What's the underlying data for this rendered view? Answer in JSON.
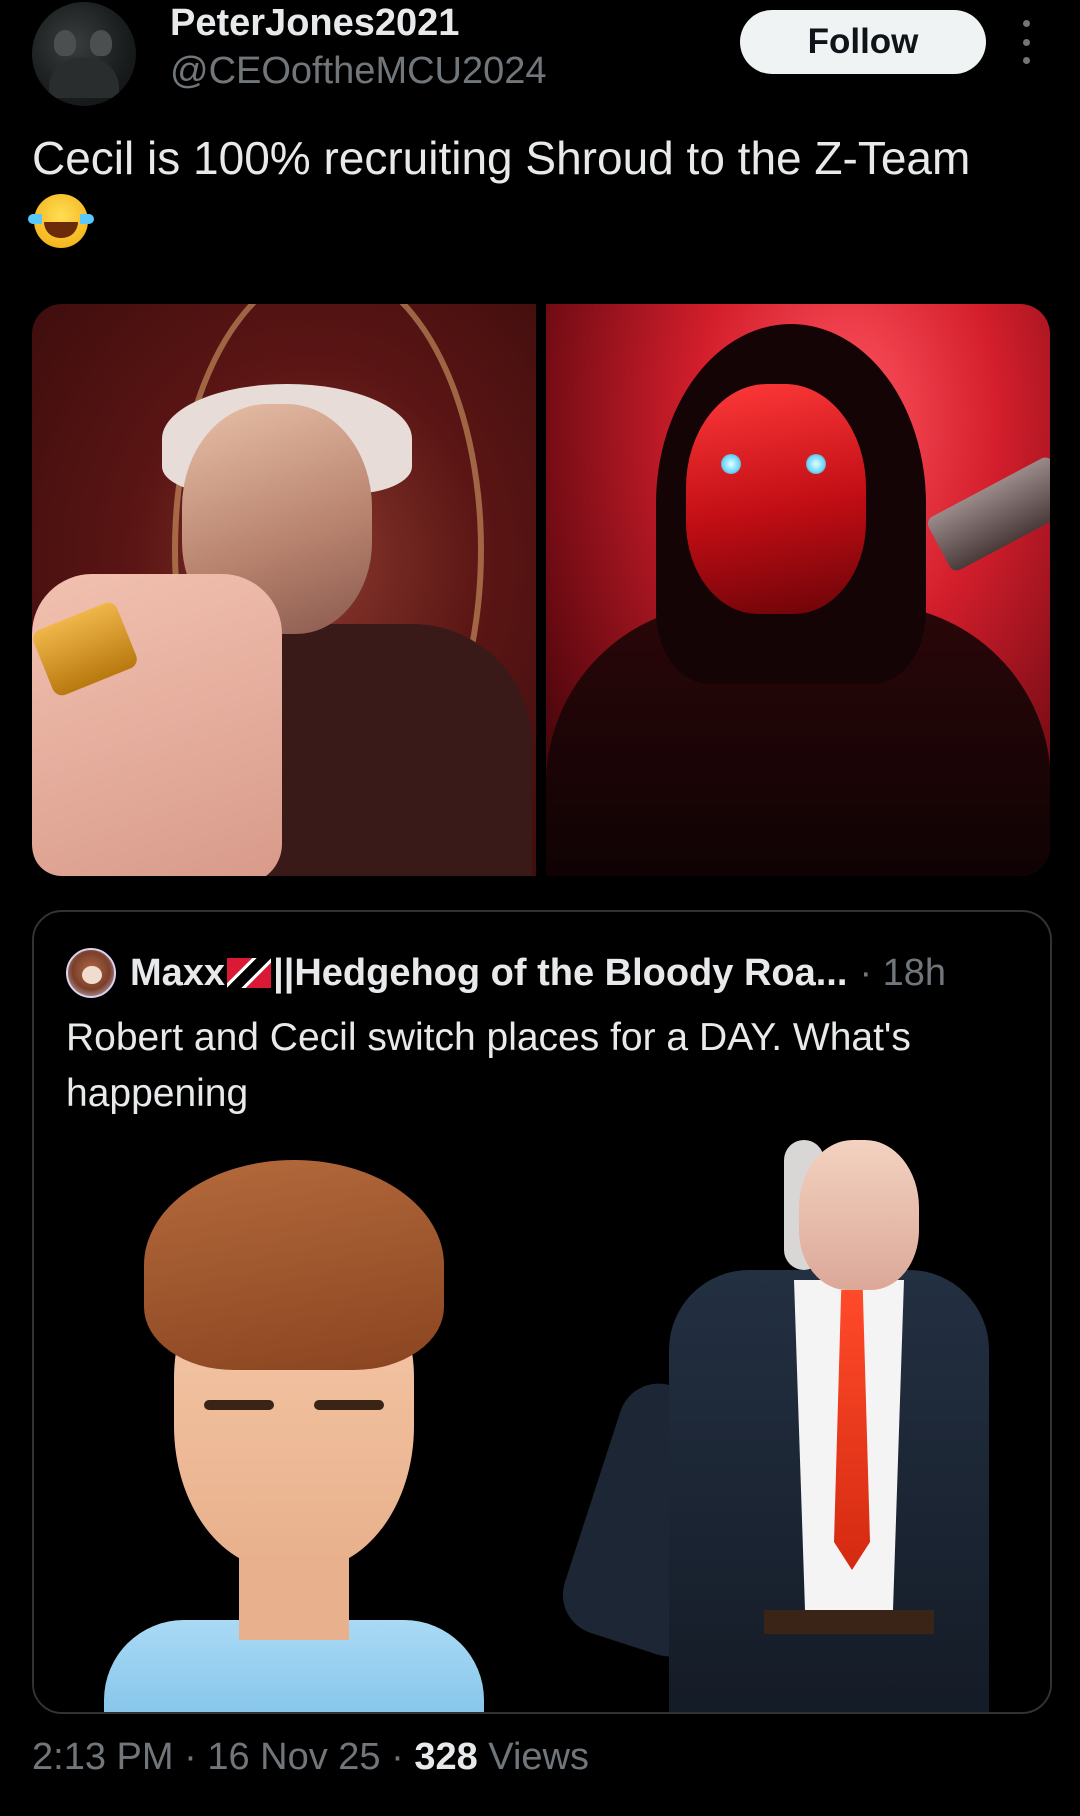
{
  "post": {
    "author": {
      "display_name": "PeterJones2021",
      "handle": "@CEOoftheMCU2024"
    },
    "follow_label": "Follow",
    "text": "Cecil is 100% recruiting Shroud to the Z-Team",
    "emoji": "face-with-tears-of-joy-icon",
    "images": [
      {
        "name": "cecil-image"
      },
      {
        "name": "shroud-image"
      }
    ],
    "timestamp": {
      "time": "2:13 PM",
      "sep1": "·",
      "date": "16 Nov 25",
      "sep2": "·",
      "views_count": "328",
      "views_label": "Views"
    }
  },
  "quoted_post": {
    "author_name_part1": "Maxx",
    "flag_icon": "trinidad-and-tobago-flag-icon",
    "author_name_part2": "||Hedgehog of the Bloody Roa...",
    "meta": "· 18h",
    "text": "Robert and Cecil switch places for a DAY. What's happening",
    "images": [
      {
        "name": "robert-image"
      },
      {
        "name": "cecil-suit-image"
      }
    ]
  },
  "colors": {
    "background": "#000000",
    "text_primary": "#e7e9ea",
    "text_secondary": "#71767b",
    "follow_bg": "#eff3f4",
    "border": "#2f3336"
  }
}
